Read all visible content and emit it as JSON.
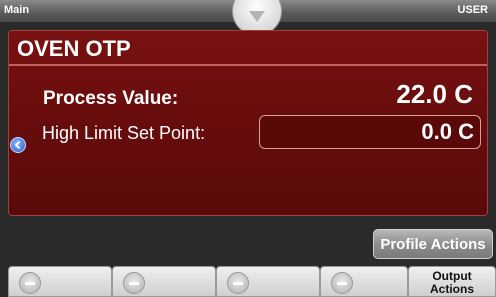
{
  "topbar": {
    "left_label": "Main",
    "right_label": "USER"
  },
  "panel": {
    "title": "OVEN OTP",
    "process_value_label": "Process Value:",
    "process_value": "22.0 C",
    "high_limit_label": "High Limit Set Point:",
    "high_limit_value": "0.0 C"
  },
  "profile_actions_label": "Profile Actions",
  "softkeys": [
    "",
    "",
    "",
    "",
    "Output\nActions"
  ],
  "colors": {
    "panel": "#6a0d0d",
    "panel_border": "#c86060",
    "nav_icon": "#2f62d8"
  }
}
